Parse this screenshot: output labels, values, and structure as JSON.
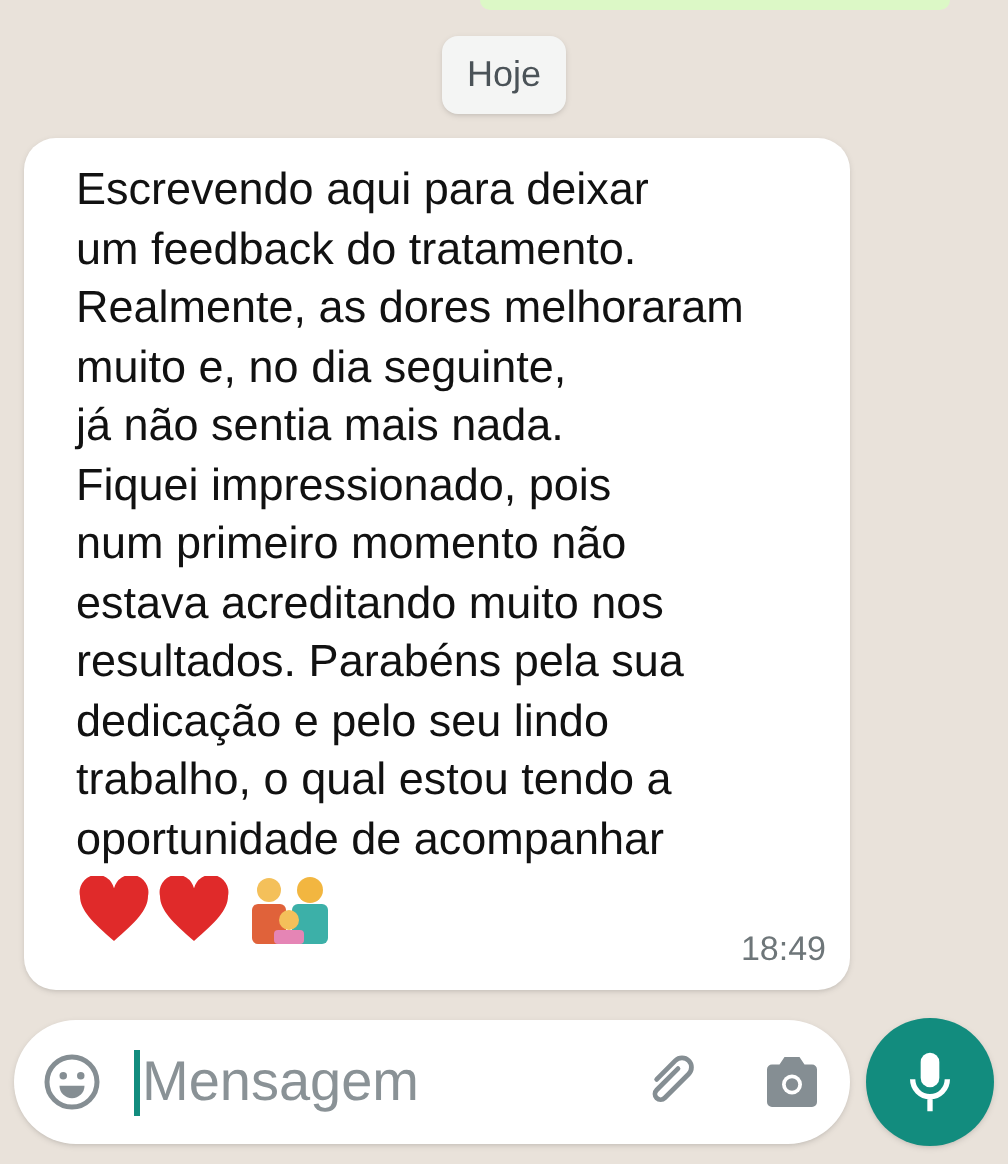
{
  "date_chip": "Hoje",
  "message": {
    "lines": [
      "Escrevendo aqui para deixar",
      "um feedback do tratamento.",
      "Realmente, as dores melhoraram",
      "muito e, no dia seguinte,",
      "já não sentia mais nada.",
      "Fiquei impressionado, pois",
      "num primeiro momento não",
      "estava acreditando muito nos",
      "resultados. Parabéns pela sua",
      "dedicação e pelo seu lindo",
      "trabalho, o qual estou tendo a",
      "oportunidade de acompanhar"
    ],
    "time": "18:49"
  },
  "composer": {
    "placeholder": "Mensagem"
  }
}
